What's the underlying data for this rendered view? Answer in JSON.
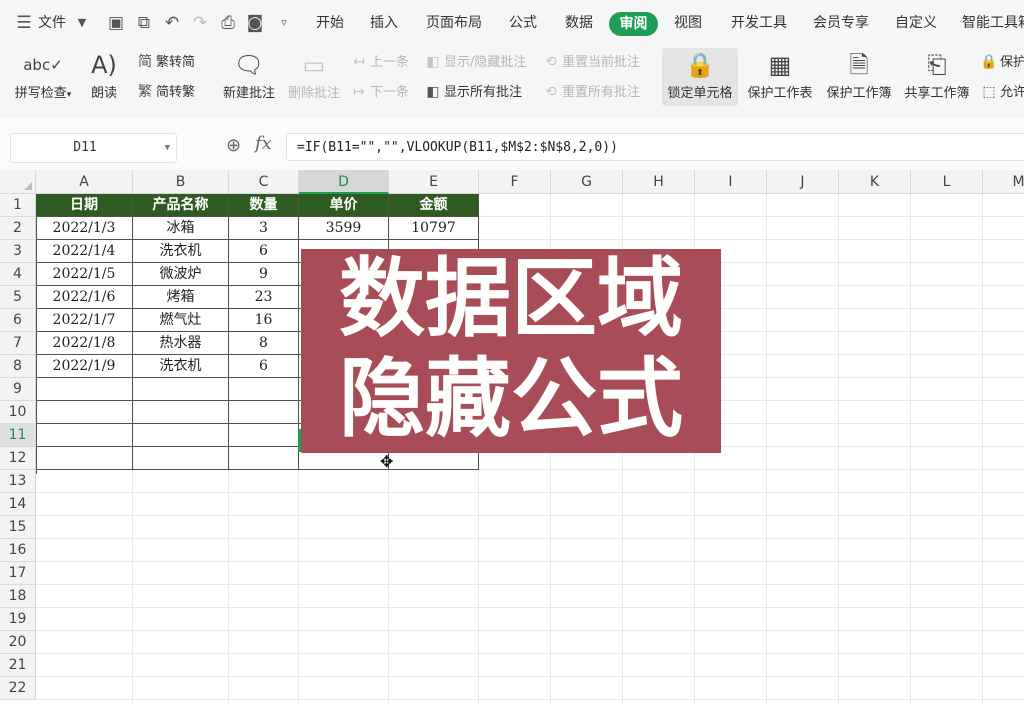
{
  "menubar": {
    "file_label": "文件",
    "tabs": [
      "开始",
      "插入",
      "页面布局",
      "公式",
      "数据",
      "审阅",
      "视图",
      "开发工具",
      "会员专享",
      "自定义",
      "智能工具箱"
    ],
    "active_tab": "审阅"
  },
  "ribbon": {
    "spellcheck": "拼写检查",
    "read_aloud": "朗读",
    "trad_to_simp": "繁转简",
    "simp_to_trad": "简转繁",
    "new_comment": "新建批注",
    "delete_comment": "删除批注",
    "prev_comment": "上一条",
    "next_comment": "下一条",
    "show_hide_comment": "显示/隐藏批注",
    "show_all_comments": "显示所有批注",
    "reset_current_comment": "重置当前批注",
    "reset_all_comments": "重置所有批注",
    "lock_cell": "锁定单元格",
    "protect_sheet": "保护工作表",
    "protect_workbook": "保护工作簿",
    "share_workbook": "共享工作簿",
    "protect_partial": "保护",
    "allow_edit": "允许"
  },
  "formula_bar": {
    "name_box": "D11",
    "formula": "=IF(B11=\"\",\"\",VLOOKUP(B11,$M$2:$N$8,2,0))"
  },
  "sheet": {
    "columns": [
      "A",
      "B",
      "C",
      "D",
      "E",
      "F",
      "G",
      "H",
      "I",
      "J",
      "K",
      "L",
      "M"
    ],
    "rows": [
      "1",
      "2",
      "3",
      "4",
      "5",
      "6",
      "7",
      "8",
      "9",
      "10",
      "11",
      "12",
      "13",
      "14",
      "15",
      "16",
      "17",
      "18",
      "19",
      "20",
      "21",
      "22"
    ],
    "selected_column": "D",
    "selected_row": "11",
    "headers": [
      "日期",
      "产品名称",
      "数量",
      "单价",
      "金额"
    ],
    "data": [
      [
        "2022/1/3",
        "冰箱",
        "3",
        "3599",
        "10797"
      ],
      [
        "2022/1/4",
        "洗衣机",
        "6",
        "",
        ""
      ],
      [
        "2022/1/5",
        "微波炉",
        "9",
        "",
        ""
      ],
      [
        "2022/1/6",
        "烤箱",
        "23",
        "",
        ""
      ],
      [
        "2022/1/7",
        "燃气灶",
        "16",
        "",
        ""
      ],
      [
        "2022/1/8",
        "热水器",
        "8",
        "",
        ""
      ],
      [
        "2022/1/9",
        "洗衣机",
        "6",
        "",
        ""
      ]
    ]
  },
  "banner": {
    "line1": "数据区域",
    "line2": "隐藏公式",
    "color": "#a84d57"
  },
  "colors": {
    "accent": "#1f9d55",
    "header_fill": "#2e5b21"
  }
}
